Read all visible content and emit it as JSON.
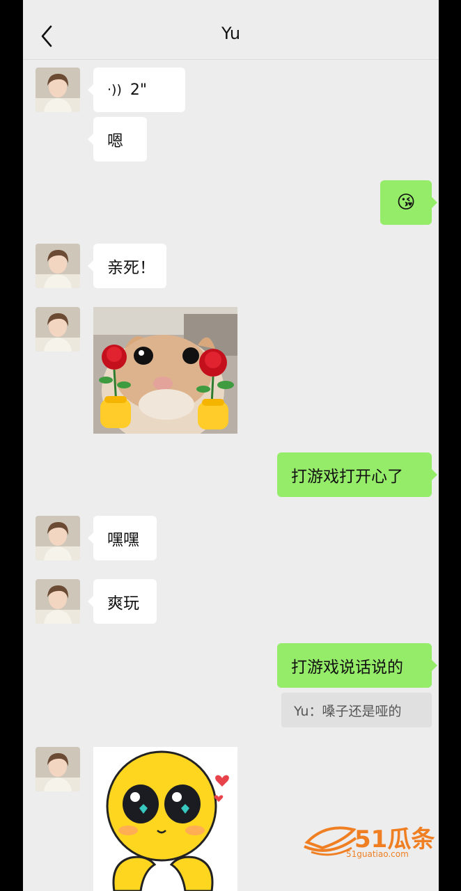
{
  "header": {
    "title": "Yu"
  },
  "messages": {
    "voice_duration": "2\"",
    "m_en": "嗯",
    "m_emoji": "😘",
    "m_qinsi": "亲死！",
    "m_game_happy": "打游戏打开心了",
    "m_heihei": "嘿嘿",
    "m_shuangwan": "爽玩",
    "m_game_talk": "打游戏说话说的",
    "quote_text": "Yu：嗓子还是哑的"
  },
  "watermark": {
    "brand": "51瓜条",
    "url": "51guatiao.com"
  },
  "colors": {
    "background": "#ededed",
    "incoming_bubble": "#ffffff",
    "outgoing_bubble": "#95ec69"
  }
}
